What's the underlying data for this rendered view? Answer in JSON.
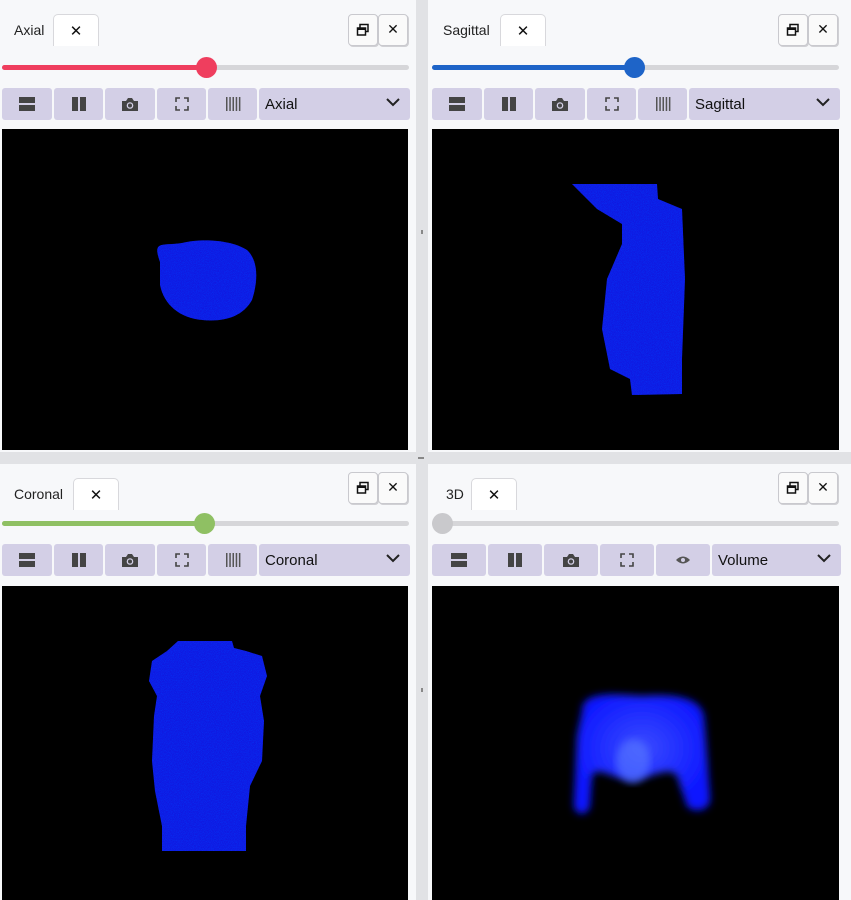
{
  "colors": {
    "axial_accent": "#ef3e5e",
    "sagittal_accent": "#1e64c8",
    "coronal_accent": "#8fc063",
    "volume_accent": "#c9c9cc",
    "toolbar_button": "#d3cfe6",
    "viewport_bg": "#000000",
    "tissue": "#1a22ff"
  },
  "panes": {
    "axial": {
      "tab_label": "Axial",
      "close_icon": "close-icon",
      "maximize_icon": "restore-window-icon",
      "slider_value": 0.5,
      "view_select": "Axial",
      "tools": [
        "layout-rows-icon",
        "layout-columns-icon",
        "camera-icon",
        "fullscreen-icon",
        "barcode-icon"
      ]
    },
    "sagittal": {
      "tab_label": "Sagittal",
      "close_icon": "close-icon",
      "maximize_icon": "restore-window-icon",
      "slider_value": 0.5,
      "view_select": "Sagittal",
      "tools": [
        "layout-rows-icon",
        "layout-columns-icon",
        "camera-icon",
        "fullscreen-icon",
        "barcode-icon"
      ]
    },
    "coronal": {
      "tab_label": "Coronal",
      "close_icon": "close-icon",
      "maximize_icon": "restore-window-icon",
      "slider_value": 0.5,
      "view_select": "Coronal",
      "tools": [
        "layout-rows-icon",
        "layout-columns-icon",
        "camera-icon",
        "fullscreen-icon",
        "barcode-icon"
      ]
    },
    "volume": {
      "tab_label": "3D",
      "close_icon": "close-icon",
      "maximize_icon": "restore-window-icon",
      "slider_value": 0.0,
      "view_select": "Volume",
      "tools": [
        "layout-rows-icon",
        "layout-columns-icon",
        "camera-icon",
        "fullscreen-icon",
        "eye-icon"
      ]
    }
  }
}
